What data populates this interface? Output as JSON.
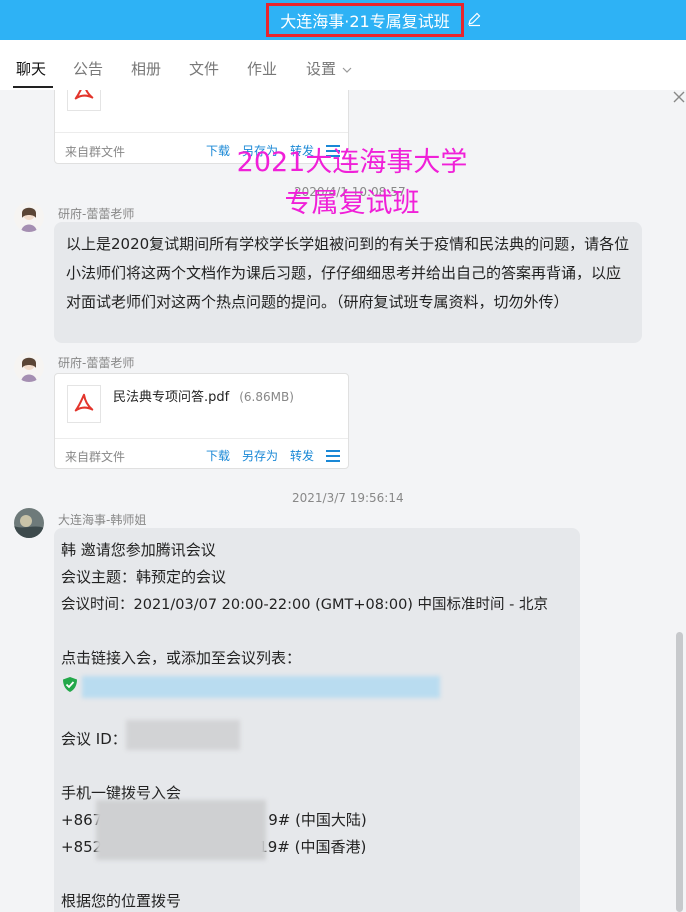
{
  "window": {
    "title": "大连海事·21专属复试班"
  },
  "tabs": [
    {
      "label": "聊天"
    },
    {
      "label": "公告"
    },
    {
      "label": "相册"
    },
    {
      "label": "文件"
    },
    {
      "label": "作业"
    },
    {
      "label": "设置"
    }
  ],
  "watermark": {
    "line1": "2021大连海事大学",
    "line2": "专属复试班"
  },
  "messages": {
    "file1": {
      "source": "来自群文件",
      "actions": {
        "download": "下载",
        "save_as": "另存为",
        "forward": "转发"
      }
    },
    "ts1": "2020/4/1 10:08:57",
    "msg1": {
      "sender": "研府-蕾蕾老师",
      "text": "以上是2020复试期间所有学校学长学姐被问到的有关于疫情和民法典的问题，请各位小法师们将这两个文档作为课后习题，仔仔细细思考并给出自己的答案再背诵，以应对面试老师们对这两个热点问题的提问。（研府复试班专属资料，切勿外传）"
    },
    "msg2": {
      "sender": "研府-蕾蕾老师",
      "file_name": "民法典专项问答.pdf",
      "file_size": "(6.86MB)",
      "source": "来自群文件",
      "actions": {
        "download": "下载",
        "save_as": "另存为",
        "forward": "转发"
      }
    },
    "ts2": "2021/3/7 19:56:14",
    "msg3": {
      "sender": "大连海事-韩师姐",
      "line1": "韩 邀请您参加腾讯会议",
      "line2": "会议主题：韩预定的会议",
      "line3": "会议时间：2021/03/07 20:00-22:00 (GMT+08:00) 中国标准时间 - 北京",
      "line4": "点击链接入会，或添加至会议列表：",
      "meeting_id_label": "会议 ID：",
      "dial_label": "手机一键拨号入会",
      "phone1_prefix": "+867",
      "phone1_suffix": "9# (中国大陆)",
      "phone2_prefix": "+852",
      "phone2_suffix": "19# (中国香港)",
      "location_label": "根据您的位置拨号"
    }
  },
  "colors": {
    "titlebar": "#2eb2f5",
    "highlight_border": "#e8252c",
    "link": "#1a88d6",
    "watermark": "#f020d8",
    "bubble": "#e6e8eb"
  }
}
